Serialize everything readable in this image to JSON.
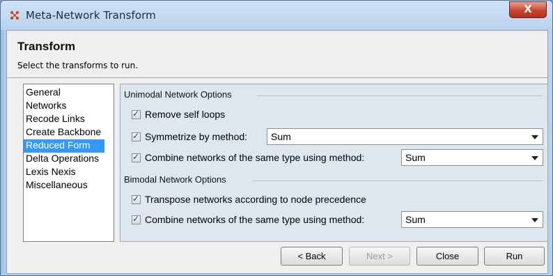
{
  "window": {
    "title": "Meta-Network Transform",
    "close_label": "X"
  },
  "header": {
    "title": "Transform",
    "subtitle": "Select the transforms to run."
  },
  "nav": {
    "items": [
      {
        "label": "General",
        "selected": false
      },
      {
        "label": "Networks",
        "selected": false
      },
      {
        "label": "Recode Links",
        "selected": false
      },
      {
        "label": "Create Backbone",
        "selected": false
      },
      {
        "label": "Reduced Form",
        "selected": true
      },
      {
        "label": "Delta Operations",
        "selected": false
      },
      {
        "label": "Lexis Nexis",
        "selected": false
      },
      {
        "label": "Miscellaneous",
        "selected": false
      }
    ]
  },
  "unimodal": {
    "title": "Unimodal Network Options",
    "remove_self_loops": {
      "label": "Remove self loops",
      "checked": true
    },
    "symmetrize": {
      "label": "Symmetrize by method:",
      "checked": true,
      "value": "Sum"
    },
    "combine": {
      "label": "Combine networks of the same type using method:",
      "checked": true,
      "value": "Sum"
    }
  },
  "bimodal": {
    "title": "Bimodal Network Options",
    "transpose": {
      "label": "Transpose networks according to node precedence",
      "checked": true
    },
    "combine": {
      "label": "Combine networks of the same type using method:",
      "checked": true,
      "value": "Sum"
    }
  },
  "buttons": {
    "back": "< Back",
    "next": "Next >",
    "close": "Close",
    "run": "Run"
  },
  "colors": {
    "selection": "#3399ff",
    "close_button": "#c9442d",
    "panel": "#dee6ef"
  }
}
